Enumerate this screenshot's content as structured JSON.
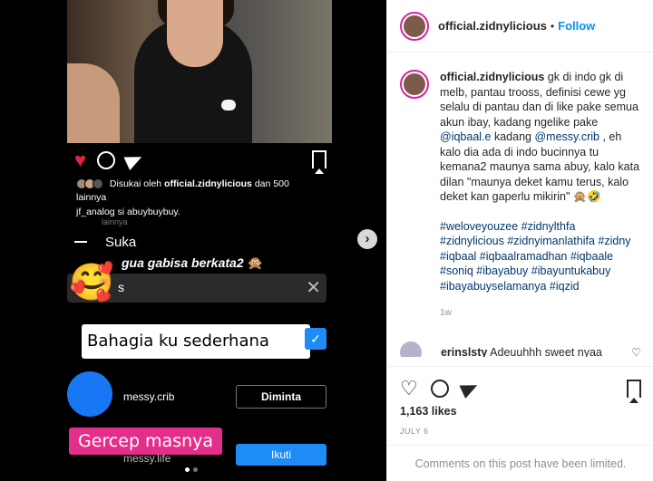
{
  "post": {
    "username": "official.zidnylicious",
    "dot": "•",
    "follow_label": "Follow"
  },
  "media": {
    "liked_prefix": "Disukai oleh",
    "liked_user": "official.zidnylicious",
    "liked_suffix": "dan 500 lainnya",
    "caption_user": "jf_analog",
    "caption_text": "si abuybuybuy.",
    "caption_faded": "lainnya",
    "sheet_title": "Suka",
    "overlay_text": "gua gabisa berkata2",
    "overlay_emoji": "🙊",
    "search_value": "s",
    "big_emoji": "🥰",
    "sticker_1": "Bahagia ku sederhana",
    "sticker_1_icon": "✓",
    "sticker_2": "Gercep masnya",
    "user_1": "messy.crib",
    "user_1_button": "Diminta",
    "user_2": "messy.life",
    "user_2_button": "Ikuti",
    "next_icon": "›"
  },
  "caption": {
    "username": "official.zidnylicious",
    "text_1": "gk di indo gk di melb, pantau trooss, definisi cewe yg selalu di pantau dan di like pake semua akun ibay, kadang ngelike pake",
    "mention_1": "@iqbaal.e",
    "text_2": "kadang",
    "mention_2": "@messy.crib",
    "text_3": ", eh kalo dia ada di indo bucinnya tu kemana2 maunya sama abuy, kalo kata dilan \"maunya deket kamu terus, kalo deket kan gaperlu mikirin\" 🙊🤣",
    "hashtags": "#weloveyouzee #zidnylthfa #zidnylicious #zidnyimanlathifa #zidny #iqbaal #iqbaalramadhan #iqbaale #soniq #ibayabuy #ibayuntukabuy #ibayabuyselamanya #iqzid",
    "age": "1w"
  },
  "comment": {
    "username": "_erinslsty",
    "text": "Adeuuhhh sweet nyaa",
    "heart_icon": "♡"
  },
  "actions": {
    "likes": "1,163 likes",
    "date": "JULY 6",
    "limited": "Comments on this post have been limited."
  }
}
